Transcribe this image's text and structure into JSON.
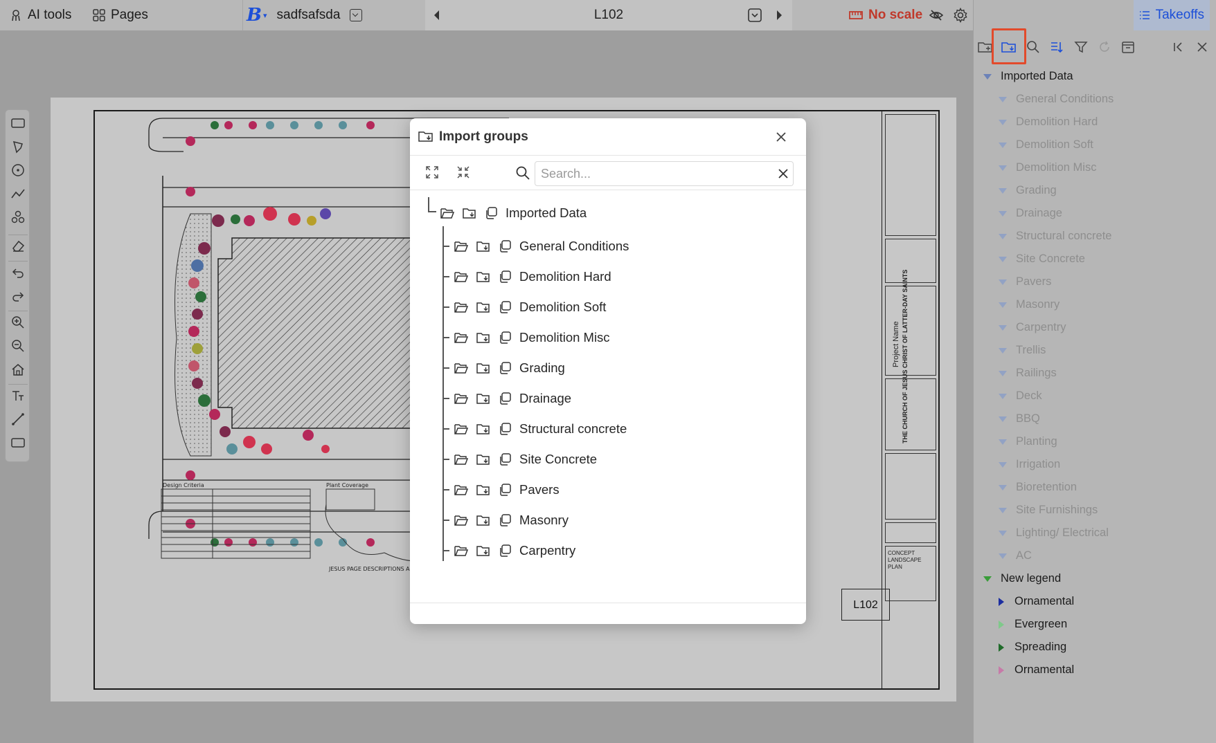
{
  "topbar": {
    "ai_tools_label": "AI tools",
    "pages_label": "Pages",
    "project_name": "sadfsafsda",
    "page_title": "L102",
    "scale_label": "No scale"
  },
  "right_panel": {
    "takeoffs_label": "Takeoffs",
    "groups": [
      {
        "label": "Imported Data",
        "level": 0,
        "state": "expanded",
        "faded": false
      },
      {
        "label": "General Conditions",
        "level": 1,
        "state": "expanded",
        "faded": true
      },
      {
        "label": "Demolition Hard",
        "level": 1,
        "state": "expanded",
        "faded": true
      },
      {
        "label": "Demolition Soft",
        "level": 1,
        "state": "expanded",
        "faded": true
      },
      {
        "label": "Demolition Misc",
        "level": 1,
        "state": "expanded",
        "faded": true
      },
      {
        "label": "Grading",
        "level": 1,
        "state": "expanded",
        "faded": true
      },
      {
        "label": "Drainage",
        "level": 1,
        "state": "expanded",
        "faded": true
      },
      {
        "label": "Structural concrete",
        "level": 1,
        "state": "expanded",
        "faded": true
      },
      {
        "label": "Site Concrete",
        "level": 1,
        "state": "expanded",
        "faded": true
      },
      {
        "label": "Pavers",
        "level": 1,
        "state": "expanded",
        "faded": true
      },
      {
        "label": "Masonry",
        "level": 1,
        "state": "expanded",
        "faded": true
      },
      {
        "label": "Carpentry",
        "level": 1,
        "state": "expanded",
        "faded": true
      },
      {
        "label": "Trellis",
        "level": 1,
        "state": "expanded",
        "faded": true
      },
      {
        "label": "Railings",
        "level": 1,
        "state": "expanded",
        "faded": true
      },
      {
        "label": "Deck",
        "level": 1,
        "state": "expanded",
        "faded": true
      },
      {
        "label": "BBQ",
        "level": 1,
        "state": "expanded",
        "faded": true
      },
      {
        "label": "Planting",
        "level": 1,
        "state": "expanded",
        "faded": true
      },
      {
        "label": "Irrigation",
        "level": 1,
        "state": "expanded",
        "faded": true
      },
      {
        "label": "Bioretention",
        "level": 1,
        "state": "expanded",
        "faded": true
      },
      {
        "label": "Site Furnishings",
        "level": 1,
        "state": "expanded",
        "faded": true
      },
      {
        "label": "Lighting/ Electrical",
        "level": 1,
        "state": "expanded",
        "faded": true
      },
      {
        "label": "AC",
        "level": 1,
        "state": "expanded",
        "faded": true
      },
      {
        "label": "New legend",
        "level": 0,
        "state": "expanded-green",
        "faded": false
      },
      {
        "label": "Ornamental",
        "level": 1,
        "state": "collapsed-blue",
        "faded": false
      },
      {
        "label": "Evergreen",
        "level": 1,
        "state": "collapsed-lightgreen",
        "faded": false
      },
      {
        "label": "Spreading",
        "level": 1,
        "state": "collapsed-green",
        "faded": false
      },
      {
        "label": "Ornamental",
        "level": 1,
        "state": "collapsed-pink",
        "faded": false
      }
    ]
  },
  "modal": {
    "title": "Import groups",
    "search_placeholder": "Search...",
    "root": "Imported Data",
    "children": [
      "General Conditions",
      "Demolition Hard",
      "Demolition Soft",
      "Demolition Misc",
      "Grading",
      "Drainage",
      "Structural concrete",
      "Site Concrete",
      "Pavers",
      "Masonry",
      "Carpentry"
    ]
  },
  "sheet": {
    "code": "L102",
    "project_name_label": "Project Name",
    "client_name": "THE CHURCH OF JESUS CHRIST OF LATTER-DAY SAINTS",
    "sheet_title": "CONCEPT LANDSCAPE PLAN"
  },
  "colors": {
    "accent_blue": "#1c4fd8",
    "warning_red": "#c0392b",
    "highlight_orange": "#e24a2b",
    "legend_green": "#3a9d3a"
  }
}
